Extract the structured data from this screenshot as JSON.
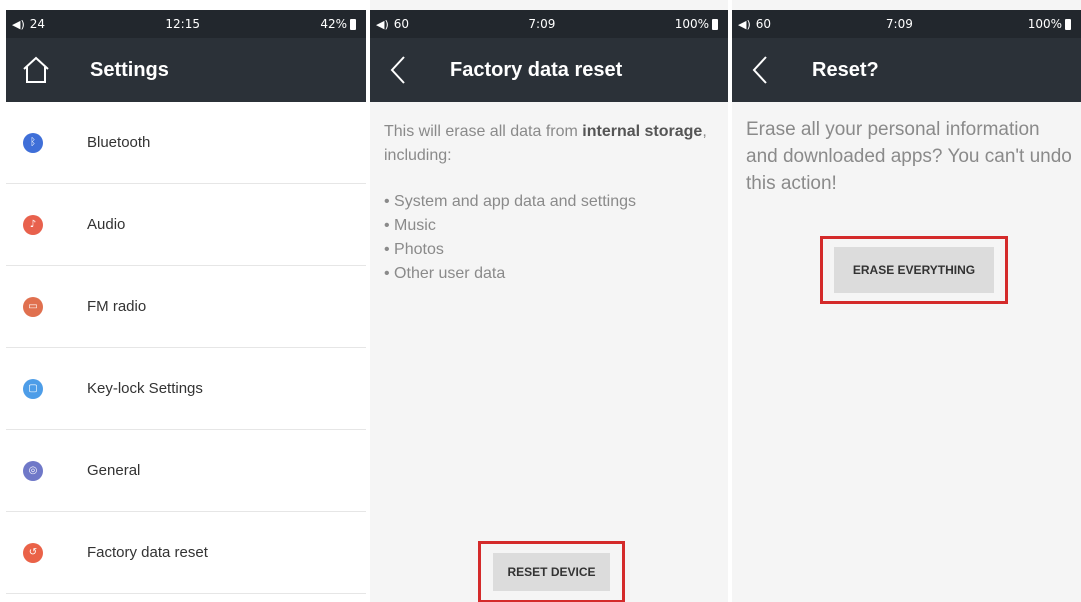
{
  "settings_panel": {
    "status": {
      "volume": "24",
      "time": "12:15",
      "battery": "42%"
    },
    "title": "Settings",
    "items": [
      {
        "label": "Bluetooth",
        "icon": "bluetooth-icon",
        "color": "#3f6fd8"
      },
      {
        "label": "Audio",
        "icon": "audio-icon",
        "color": "#e8614d"
      },
      {
        "label": "FM radio",
        "icon": "radio-icon",
        "color": "#e0704f"
      },
      {
        "label": "Key-lock Settings",
        "icon": "lock-icon",
        "color": "#4d9de8"
      },
      {
        "label": "General",
        "icon": "general-icon",
        "color": "#6f78c8"
      },
      {
        "label": "Factory data reset",
        "icon": "reset-icon",
        "color": "#ea6248"
      }
    ]
  },
  "factory_panel": {
    "status": {
      "volume": "60",
      "time": "7:09",
      "battery": "100%"
    },
    "title": "Factory data reset",
    "intro_prefix": "This will erase all data from",
    "intro_bold": "internal storage",
    "intro_suffix": ", including:",
    "bullets": [
      "System and app data and settings",
      "Music",
      "Photos",
      "Other user data"
    ],
    "button": "RESET DEVICE"
  },
  "confirm_panel": {
    "status": {
      "volume": "60",
      "time": "7:09",
      "battery": "100%"
    },
    "title": "Reset?",
    "message": "Erase all your personal information and downloaded apps? You can't undo this action!",
    "button": "ERASE EVERYTHING"
  },
  "colors": {
    "highlight": "#d42a2a",
    "appbar": "#2b3138",
    "statusbar": "#22272d"
  }
}
